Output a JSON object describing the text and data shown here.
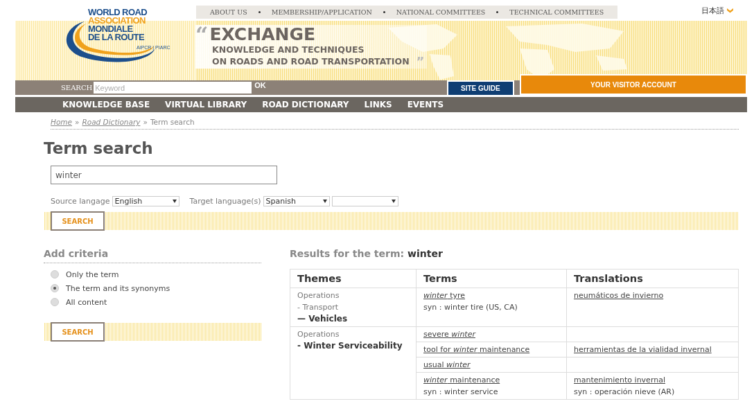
{
  "top_nav": {
    "items": [
      "ABOUT US",
      "MEMBERSHIP/APPLICATION",
      "NATIONAL COMMITTEES",
      "TECHNICAL COMMITTEES"
    ],
    "language": "日本語"
  },
  "logo": {
    "lines": [
      "WORLD ROAD",
      "ASSOCIATION",
      "MONDIALE",
      "DE LA ROUTE"
    ],
    "small": "AIPCR | PIARC"
  },
  "banner": {
    "quote_open": "“",
    "headline": "EXCHANGE",
    "sub_lines": [
      "KNOWLEDGE AND TECHNIQUES",
      "ON ROADS AND ROAD TRANSPORTATION"
    ],
    "quote_close": "”"
  },
  "search_bar": {
    "label": "SEARCH",
    "placeholder": "Keyword",
    "button": "OK",
    "site_guide": "SITE GUIDE",
    "account": "YOUR VISITOR ACCOUNT"
  },
  "main_nav": [
    "KNOWLEDGE BASE",
    "VIRTUAL LIBRARY",
    "ROAD DICTIONARY",
    "LINKS",
    "EVENTS"
  ],
  "breadcrumb": {
    "links": [
      "Home",
      "Road Dictionary"
    ],
    "separator": "»",
    "current": "Term search"
  },
  "title": "Term search",
  "term_field": {
    "value": "winter"
  },
  "source": {
    "label": "Source langage",
    "value": "English"
  },
  "target": {
    "label": "Target language(s)",
    "selects": [
      {
        "kind": "select",
        "value": "Spanish"
      },
      {
        "kind": "select"
      }
    ]
  },
  "search_button": "SEARCH",
  "criteria": {
    "title": "Add criteria",
    "options": [
      {
        "label": "Only the term",
        "selected": false
      },
      {
        "label": "The term and its synonyms",
        "selected": true
      },
      {
        "label": "All content",
        "selected": false
      }
    ],
    "button": "SEARCH"
  },
  "results": {
    "label": "Results for the term:",
    "term": "winter",
    "columns": [
      "Themes",
      "Terms",
      "Translations"
    ],
    "groups": [
      {
        "theme": [
          {
            "text": "Operations",
            "bold": false
          },
          {
            "text": "- Transport",
            "bold": false
          },
          {
            "text": "— Vehicles",
            "bold": true
          }
        ],
        "rows": [
          {
            "term": "*winter* tyre",
            "term_syn": "syn : winter tire (US, CA)",
            "translation": "neumáticos de invierno"
          }
        ]
      },
      {
        "theme": [
          {
            "text": "Operations",
            "bold": false
          },
          {
            "text": "- Winter Serviceability",
            "bold": true
          }
        ],
        "rows": [
          {
            "term": "severe *winter*"
          },
          {
            "term": "tool for *winter* maintenance",
            "translation": "herramientas de la vialidad invernal"
          },
          {
            "term": "usual *winter*"
          },
          {
            "term": "*winter* maintenance",
            "term_syn": "syn : winter service",
            "translation": "mantenimiento invernal",
            "translation_syn": "syn : operación nieve (AR)"
          }
        ]
      }
    ]
  }
}
